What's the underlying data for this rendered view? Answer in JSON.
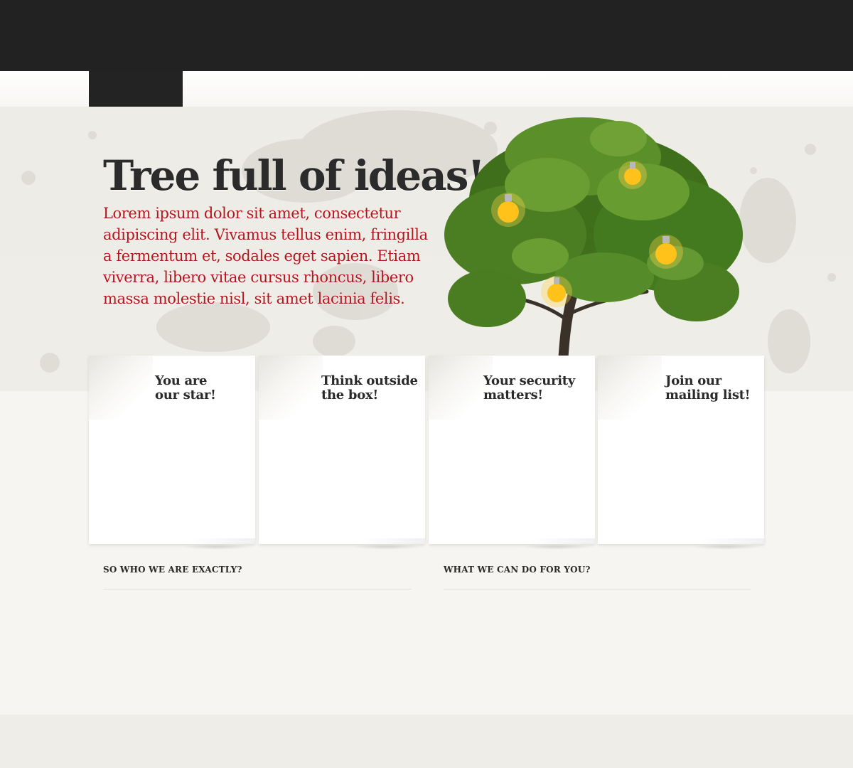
{
  "hero": {
    "title": "Tree full of ideas!",
    "text": "Lorem ipsum dolor sit amet, consectetur adipiscing elit. Vivamus tellus enim, fringilla a fermentum et, sodales eget sapien. Etiam viverra, libero vitae cursus rhoncus, libero massa molestie nisl, sit amet lacinia felis."
  },
  "cards": [
    {
      "line1": "You are",
      "line2": "our star!"
    },
    {
      "line1": "Think outside",
      "line2": "the box!"
    },
    {
      "line1": "Your security",
      "line2": "matters!"
    },
    {
      "line1": "Join our",
      "line2": "mailing list!"
    }
  ],
  "sections": {
    "left_heading": "SO WHO WE ARE EXACTLY?",
    "right_heading": "WHAT WE CAN DO FOR YOU?"
  },
  "colors": {
    "topbar": "#222222",
    "accent_red": "#b0171c",
    "heading": "#2b2b2b",
    "page_bg": "#f6f5f1",
    "hero_bg": "#eeece6"
  },
  "icons": {
    "logo": "logo-tab",
    "illustration": "tree-with-lightbulbs"
  }
}
